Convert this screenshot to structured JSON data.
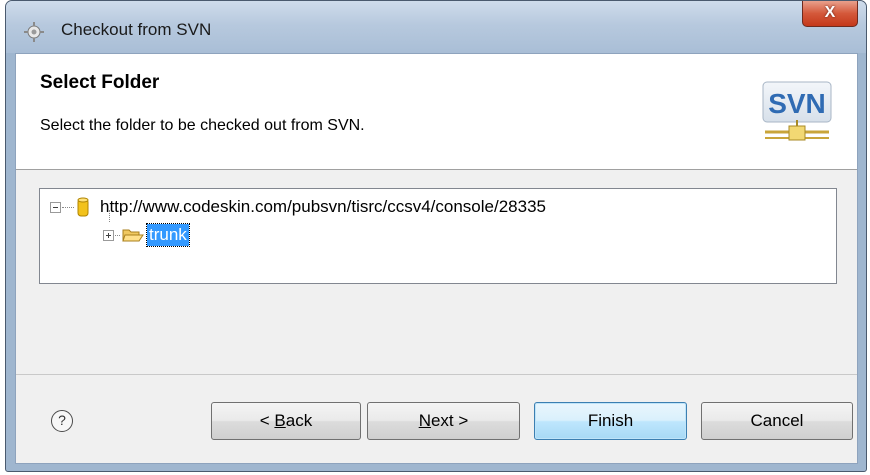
{
  "window": {
    "title": "Checkout from SVN",
    "close_label": "X"
  },
  "header": {
    "title": "Select Folder",
    "description": "Select the folder to be checked out from SVN.",
    "logo_text": "SVN"
  },
  "tree": {
    "root": {
      "label": "http://www.codeskin.com/pubsvn/tisrc/ccsv4/console/28335",
      "icon": "repository-icon",
      "expanded": true
    },
    "children": [
      {
        "label": "trunk",
        "icon": "folder-icon",
        "expanded": false,
        "selected": true
      }
    ]
  },
  "footer": {
    "help_label": "?",
    "buttons": {
      "back": {
        "prefix": "< ",
        "mnemonic": "B",
        "rest": "ack"
      },
      "next": {
        "mnemonic": "N",
        "rest": "ext >"
      },
      "finish": {
        "label": "Finish"
      },
      "cancel": {
        "label": "Cancel"
      }
    }
  },
  "colors": {
    "selection": "#3399ff",
    "titlebar": "#b7c9de",
    "close_button": "#c4381a",
    "default_button": "#bee6fd"
  }
}
